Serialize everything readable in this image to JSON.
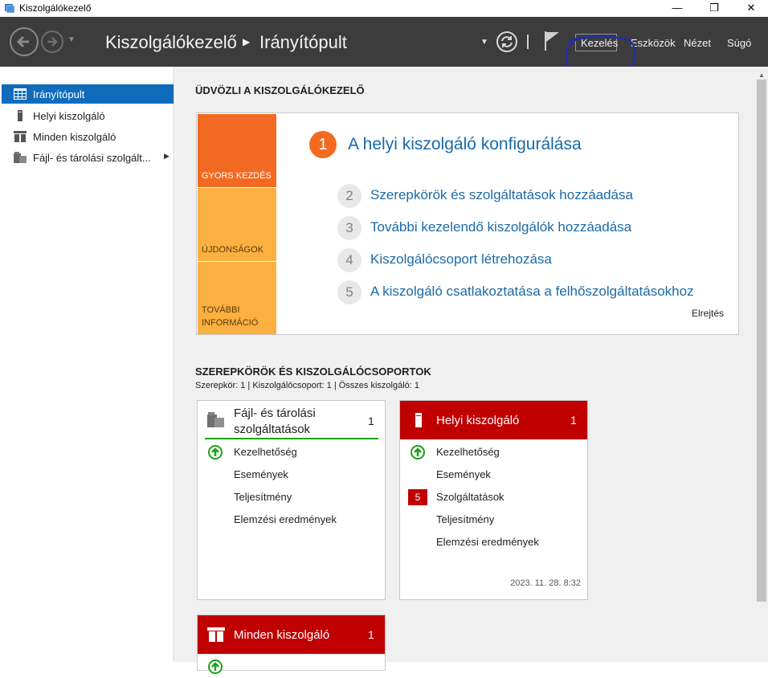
{
  "window": {
    "title": "Kiszolgálókezelő",
    "minimize": "—",
    "maximize": "❐",
    "close": "✕"
  },
  "header": {
    "breadcrumb": [
      "Kiszolgálókezelő",
      "Irányítópult"
    ],
    "menu": [
      "Kezelés",
      "Eszközök",
      "Nézet",
      "Súgó"
    ]
  },
  "sidebar": {
    "items": [
      {
        "label": "Irányítópult",
        "icon": "dashboard-icon",
        "active": true
      },
      {
        "label": "Helyi kiszolgáló",
        "icon": "server-icon",
        "active": false
      },
      {
        "label": "Minden kiszolgáló",
        "icon": "servers-icon",
        "active": false
      },
      {
        "label": "Fájl- és tárolási szolgált...",
        "icon": "file-storage-icon",
        "active": false
      }
    ]
  },
  "welcome": {
    "title": "ÜDVÖZLI A KISZOLGÁLÓKEZELŐ",
    "tabs": [
      "GYORS KEZDÉS",
      "ÚJDONSÁGOK",
      "TOVÁBBI INFORMÁCIÓ"
    ],
    "steps": [
      {
        "num": "1",
        "text": "A helyi kiszolgáló konfigurálása"
      },
      {
        "num": "2",
        "text": "Szerepkörök és szolgáltatások hozzáadása"
      },
      {
        "num": "3",
        "text": "További kezelendő kiszolgálók hozzáadása"
      },
      {
        "num": "4",
        "text": "Kiszolgálócsoport létrehozása"
      },
      {
        "num": "5",
        "text": "A kiszolgáló csatlakoztatása a felhőszolgáltatásokhoz"
      }
    ],
    "hide": "Elrejtés"
  },
  "roles": {
    "title": "SZEREPKÖRÖK ÉS KISZOLGÁLÓCSOPORTOK",
    "summary": "Szerepkör: 1 | Kiszolgálócsoport: 1 | Összes kiszolgáló: 1",
    "tiles": [
      {
        "name_line1": "Fájl- és tárolási",
        "name_line2": "szolgáltatások",
        "count": "1",
        "rows": [
          "Kezelhetőség",
          "Események",
          "Teljesítmény",
          "Elemzési eredmények"
        ]
      },
      {
        "name": "Helyi kiszolgáló",
        "count": "1",
        "rows": [
          "Kezelhetőség",
          "Események",
          "Szolgáltatások",
          "Teljesítmény",
          "Elemzési eredmények"
        ],
        "services_badge": "5",
        "timestamp": "2023. 11. 28. 8:32"
      },
      {
        "name": "Minden kiszolgáló",
        "count": "1"
      }
    ]
  },
  "colors": {
    "header_bg": "#3c3c3c",
    "accent_blue": "#0f6cbd",
    "orange": "#f26a21",
    "amber": "#fbb040",
    "tile_red": "#c00000",
    "ok_green": "#19a319"
  }
}
